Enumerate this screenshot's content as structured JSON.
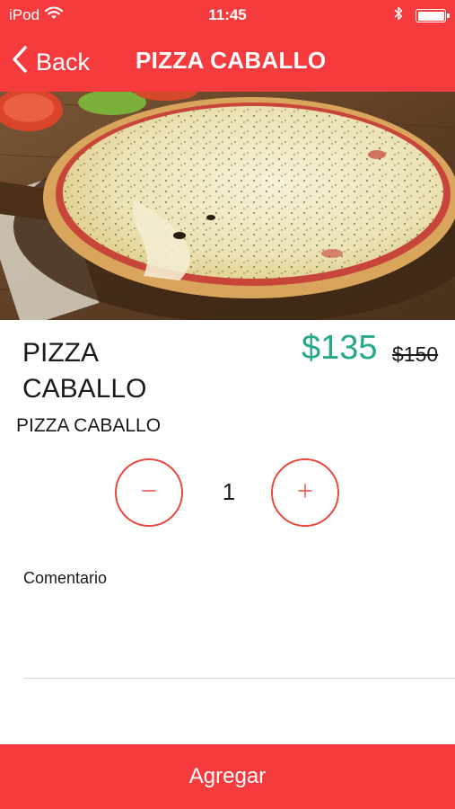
{
  "status_bar": {
    "carrier": "iPod",
    "time": "11:45",
    "wifi_icon": "wifi-icon",
    "bluetooth_icon": "bluetooth-icon",
    "battery_level": 1.0
  },
  "nav": {
    "back_label": "Back",
    "back_icon": "chevron-left-icon",
    "title": "PIZZA CABALLO"
  },
  "product": {
    "image": "pizza-photo",
    "name": "PIZZA CABALLO",
    "price": "$135",
    "old_price": "$150",
    "description": "PIZZA CABALLO"
  },
  "quantity": {
    "value": "1",
    "minus_icon": "minus-icon",
    "plus_icon": "plus-icon"
  },
  "comment": {
    "label": "Comentario",
    "value": ""
  },
  "actions": {
    "add_label": "Agregar"
  },
  "colors": {
    "header": "#f53b3e",
    "price": "#26a98a",
    "stepper": "#e8493f"
  }
}
